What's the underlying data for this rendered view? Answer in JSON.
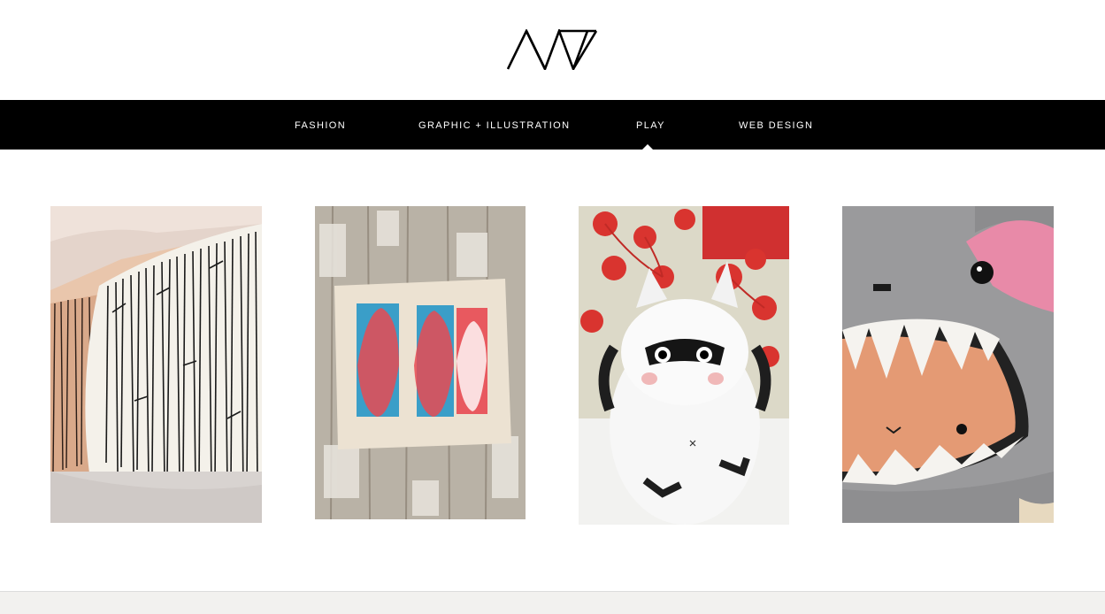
{
  "brand": {
    "logo_text": "AW",
    "logo_icon": "aw-monogram-logo"
  },
  "nav": {
    "items": [
      {
        "label": "FASHION",
        "active": false
      },
      {
        "label": "GRAPHIC + ILLUSTRATION",
        "active": false
      },
      {
        "label": "PLAY",
        "active": true
      },
      {
        "label": "WEB DESIGN",
        "active": false
      }
    ]
  },
  "gallery": {
    "items": [
      {
        "subject": "sketched-tree-pillow-photo"
      },
      {
        "subject": "screenprinted-faces-pillow-photo"
      },
      {
        "subject": "white-raccoon-plush-photo"
      },
      {
        "subject": "grey-monster-plush-photo"
      }
    ]
  },
  "colors": {
    "nav_background": "#000000",
    "nav_text": "#ffffff",
    "page_background": "#ffffff"
  }
}
